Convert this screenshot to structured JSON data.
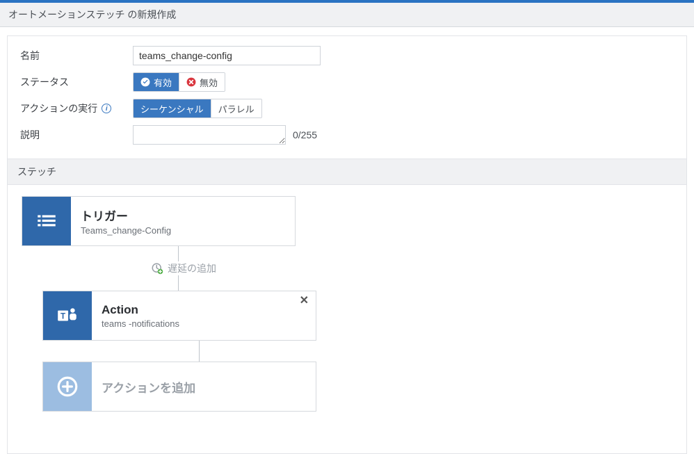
{
  "page": {
    "title": "オートメーションステッチ の新規作成"
  },
  "form": {
    "name_label": "名前",
    "name_value": "teams_change-config",
    "status_label": "ステータス",
    "status_options": {
      "enabled": "有効",
      "disabled": "無効"
    },
    "exec_label": "アクションの実行",
    "exec_options": {
      "sequential": "シーケンシャル",
      "parallel": "パラレル"
    },
    "desc_label": "説明",
    "desc_value": "",
    "desc_counter": "0/255"
  },
  "stitch": {
    "header": "ステッチ",
    "trigger": {
      "title": "トリガー",
      "sub": "Teams_change-Config"
    },
    "delay_label": "遅延の追加",
    "action": {
      "title": "Action",
      "sub": "teams -notifications"
    },
    "add_action": "アクションを追加"
  }
}
